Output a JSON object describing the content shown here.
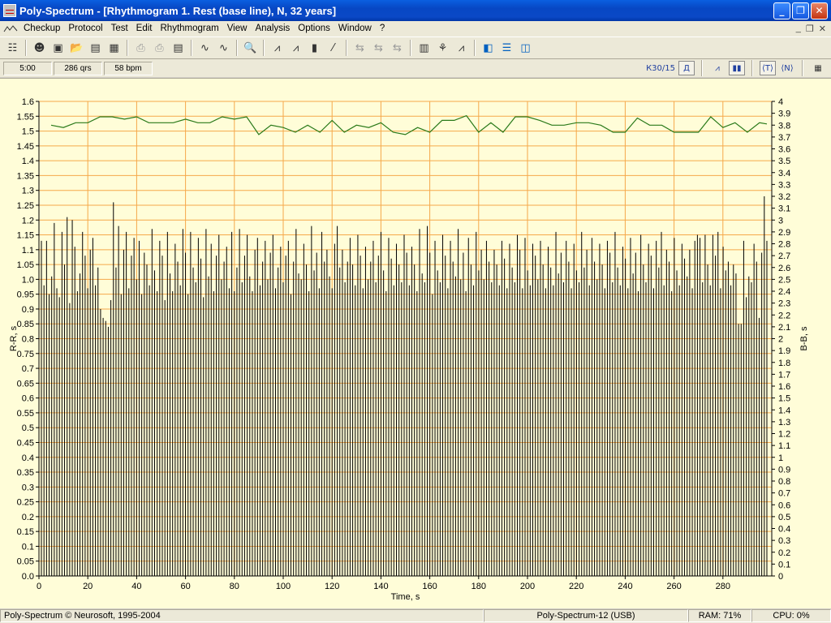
{
  "window": {
    "title": "Poly-Spectrum - [Rhythmogram 1. Rest (base line), N, 32 years]"
  },
  "menu": [
    "Checkup",
    "Protocol",
    "Test",
    "Edit",
    "Rhythmogram",
    "View",
    "Analysis",
    "Options",
    "Window",
    "?"
  ],
  "info": {
    "duration": "5:00",
    "qrs": "286 qrs",
    "bpm": "58 bpm"
  },
  "right_controls": {
    "k30": "К30/15",
    "d": "Д"
  },
  "status": {
    "copyright": "Poly-Spectrum © Neurosoft, 1995-2004",
    "device": "Poly-Spectrum-12 (USB)",
    "ram": "RAM: 71%",
    "cpu": "CPU: 0%"
  },
  "colors": {
    "bg": "#fffdd8",
    "grid": "#f5a84a",
    "bars": "#000000",
    "line": "#2a7a1a"
  },
  "chart_data": {
    "type": "bar",
    "xlabel": "Time, s",
    "ylabel_left": "R-R, s",
    "ylabel_right": "B-B, s",
    "xlim": [
      0,
      300
    ],
    "ylim_left": [
      0,
      1.6
    ],
    "ylim_right": [
      0,
      4
    ],
    "x_ticks": [
      "0",
      "20",
      "40",
      "60",
      "80",
      "100",
      "120",
      "140",
      "160",
      "180",
      "200",
      "220",
      "240",
      "260",
      "280"
    ],
    "y_ticks_left": [
      "0.0",
      "0.05",
      "0.1",
      "0.15",
      "0.2",
      "0.25",
      "0.3",
      "0.35",
      "0.4",
      "0.45",
      "0.5",
      "0.55",
      "0.6",
      "0.65",
      "0.7",
      "0.75",
      "0.8",
      "0.85",
      "0.9",
      "0.95",
      "1.0",
      "1.05",
      "1.1",
      "1.15",
      "1.2",
      "1.25",
      "1.3",
      "1.35",
      "1.4",
      "1.45",
      "1.5",
      "1.55",
      "1.6"
    ],
    "y_ticks_right": [
      "0",
      "0.1",
      "0.2",
      "0.3",
      "0.4",
      "0.5",
      "0.6",
      "0.7",
      "0.8",
      "0.9",
      "1",
      "1.1",
      "1.2",
      "1.3",
      "1.4",
      "1.5",
      "1.6",
      "1.7",
      "1.8",
      "1.9",
      "2",
      "2.1",
      "2.2",
      "2.3",
      "2.4",
      "2.5",
      "2.6",
      "2.7",
      "2.8",
      "2.9",
      "3",
      "3.1",
      "3.2",
      "3.3",
      "3.4",
      "3.5",
      "3.6",
      "3.7",
      "3.8",
      "3.9",
      "4"
    ],
    "series": [
      {
        "name": "R-R",
        "type": "bar",
        "axis": "left",
        "values": [
          1.13,
          0.98,
          1.13,
          0.95,
          1.01,
          1.19,
          0.97,
          0.94,
          1.16,
          1.05,
          1.21,
          0.92,
          1.2,
          1.11,
          0.96,
          1.02,
          1.16,
          1.08,
          0.97,
          1.1,
          1.14,
          0.98,
          1.04,
          0.9,
          0.87,
          0.86,
          0.84,
          0.93,
          1.26,
          1.04,
          1.18,
          0.95,
          1.1,
          1.16,
          0.97,
          1.08,
          1.14,
          1.0,
          1.13,
          0.95,
          1.09,
          1.05,
          0.98,
          1.17,
          1.03,
          0.96,
          1.13,
          1.08,
          0.93,
          1.16,
          1.02,
          0.96,
          1.12,
          1.06,
          0.98,
          1.17,
          1.09,
          0.95,
          1.16,
          1.04,
          0.99,
          1.14,
          1.07,
          0.94,
          1.17,
          1.01,
          1.12,
          0.96,
          1.08,
          1.15,
          1.0,
          1.06,
          1.11,
          0.97,
          1.16,
          0.96,
          1.04,
          1.17,
          0.99,
          1.08,
          1.15,
          1.01,
          0.96,
          1.1,
          1.14,
          0.98,
          1.06,
          1.13,
          1.0,
          1.09,
          1.15,
          0.97,
          1.04,
          1.11,
          0.99,
          1.08,
          1.13,
          0.95,
          1.06,
          1.17,
          1.02,
          1.0,
          1.12,
          1.05,
          0.96,
          1.18,
          1.03,
          1.09,
          0.97,
          1.16,
          1.06,
          1.1,
          1.01,
          0.97,
          1.12,
          1.18,
          1.04,
          1.1,
          0.99,
          1.06,
          1.14,
          1.05,
          0.98,
          1.15,
          1.08,
          0.97,
          1.11,
          1.0,
          1.06,
          1.13,
          0.99,
          1.08,
          1.16,
          1.03,
          0.96,
          1.14,
          1.07,
          0.98,
          1.12,
          1.05,
          0.99,
          1.15,
          1.09,
          0.98,
          1.11,
          1.05,
          0.96,
          1.17,
          1.02,
          0.99,
          1.18,
          1.09,
          0.95,
          1.13,
          1.03,
          0.99,
          1.15,
          1.08,
          0.97,
          1.13,
          1.06,
          1.01,
          1.17,
          1.0,
          1.09,
          0.96,
          1.14,
          1.05,
          0.98,
          1.16,
          1.03,
          1.1,
          1.0,
          1.13,
          1.06,
          0.99,
          1.1,
          1.05,
          0.98,
          1.13,
          1.07,
          0.97,
          1.12,
          1.04,
          0.99,
          1.15,
          1.1,
          0.97,
          1.14,
          1.03,
          0.98,
          1.12,
          1.08,
          1.0,
          1.13,
          1.05,
          0.97,
          1.11,
          1.04,
          0.98,
          1.16,
          1.02,
          1.09,
          0.99,
          1.13,
          1.06,
          0.97,
          1.12,
          1.03,
          0.99,
          1.16,
          1.04,
          1.1,
          0.98,
          1.14,
          1.06,
          1.0,
          1.12,
          1.05,
          0.97,
          1.13,
          1.09,
          0.99,
          1.16,
          1.04,
          0.98,
          1.11,
          1.07,
          0.97,
          1.14,
          1.02,
          1.09,
          0.96,
          1.15,
          1.05,
          0.99,
          1.12,
          1.08,
          0.97,
          1.13,
          1.04,
          1.16,
          0.98,
          1.1,
          1.06,
          0.96,
          1.14,
          1.03,
          0.98,
          1.12,
          1.07,
          1.01,
          1.1,
          0.97,
          1.13,
          1.15,
          1.14,
          0.99,
          1.15,
          1.05,
          0.98,
          1.15,
          1.08,
          1.16,
          0.97,
          1.11,
          1.03,
          1.06,
          0.98,
          1.05,
          1.02,
          0.85,
          0.85,
          1.13,
          0.94,
          1.01,
          0.99,
          1.12,
          1.06,
          0.87,
          1.09,
          1.28,
          1.13
        ]
      },
      {
        "name": "B-B",
        "type": "line",
        "axis": "right",
        "x": [
          5,
          10,
          15,
          20,
          25,
          30,
          35,
          40,
          45,
          50,
          55,
          60,
          65,
          70,
          75,
          80,
          85,
          90,
          95,
          100,
          105,
          110,
          115,
          120,
          125,
          130,
          135,
          140,
          145,
          150,
          155,
          160,
          165,
          170,
          175,
          180,
          185,
          190,
          195,
          200,
          205,
          210,
          215,
          220,
          225,
          230,
          235,
          240,
          245,
          250,
          255,
          260,
          265,
          270,
          275,
          280,
          285,
          290,
          295,
          298
        ],
        "values": [
          3.8,
          3.78,
          3.82,
          3.82,
          3.87,
          3.87,
          3.85,
          3.87,
          3.82,
          3.82,
          3.82,
          3.85,
          3.82,
          3.82,
          3.87,
          3.85,
          3.87,
          3.72,
          3.8,
          3.78,
          3.74,
          3.8,
          3.74,
          3.84,
          3.74,
          3.8,
          3.78,
          3.82,
          3.74,
          3.72,
          3.78,
          3.74,
          3.84,
          3.84,
          3.88,
          3.74,
          3.82,
          3.74,
          3.87,
          3.87,
          3.84,
          3.8,
          3.8,
          3.82,
          3.82,
          3.8,
          3.74,
          3.74,
          3.86,
          3.8,
          3.8,
          3.74,
          3.74,
          3.74,
          3.87,
          3.78,
          3.82,
          3.74,
          3.82,
          3.81
        ]
      }
    ]
  }
}
